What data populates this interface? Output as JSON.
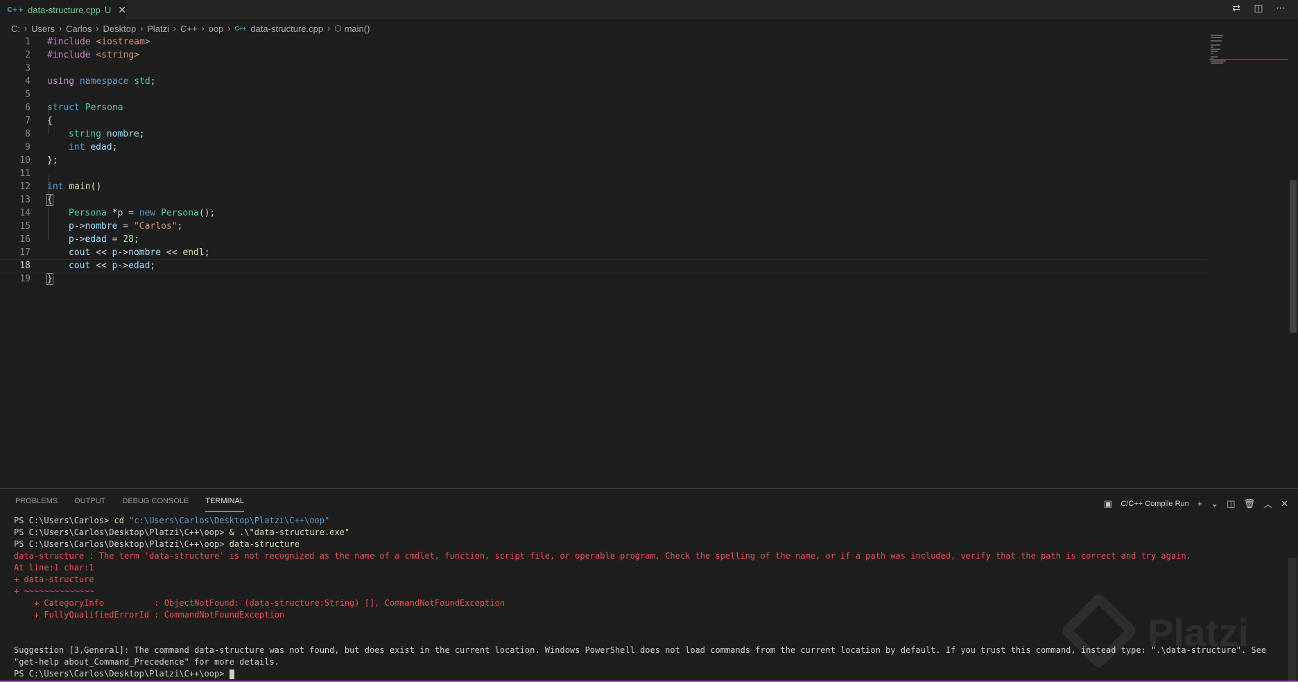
{
  "tab": {
    "icon": "C++",
    "label": "data-structure.cpp",
    "status": "U",
    "close": "✕"
  },
  "tab_actions": [
    "compare-icon",
    "split-editor-icon",
    "more-actions-icon"
  ],
  "breadcrumb": {
    "parts": [
      "C:",
      "Users",
      "Carlos",
      "Desktop",
      "Platzi",
      "C++",
      "oop"
    ],
    "file": "data-structure.cpp",
    "file_icon": "C++",
    "symbol": "main()"
  },
  "editor": {
    "current_line": 18,
    "lines": [
      {
        "n": "1"
      },
      {
        "n": "2"
      },
      {
        "n": "3"
      },
      {
        "n": "4"
      },
      {
        "n": "5"
      },
      {
        "n": "6"
      },
      {
        "n": "7"
      },
      {
        "n": "8"
      },
      {
        "n": "9"
      },
      {
        "n": "10"
      },
      {
        "n": "11"
      },
      {
        "n": "12"
      },
      {
        "n": "13"
      },
      {
        "n": "14"
      },
      {
        "n": "15"
      },
      {
        "n": "16"
      },
      {
        "n": "17"
      },
      {
        "n": "18"
      },
      {
        "n": "19"
      }
    ],
    "tokens": {
      "l1": [
        "#include",
        " ",
        "<iostream>"
      ],
      "l2": [
        "#include",
        " ",
        "<string>"
      ],
      "l4": [
        "using",
        " ",
        "namespace",
        " ",
        "std",
        ";"
      ],
      "l6": [
        "struct",
        " ",
        "Persona"
      ],
      "l7": [
        "{"
      ],
      "l8": [
        "string",
        " ",
        "nombre",
        ";"
      ],
      "l9": [
        "int",
        " ",
        "edad",
        ";"
      ],
      "l10": [
        "};"
      ],
      "l12": [
        "int",
        " ",
        "main",
        "()"
      ],
      "l13": [
        "{"
      ],
      "l14": [
        "Persona",
        " *",
        "p",
        " = ",
        "new",
        " ",
        "Persona",
        "();"
      ],
      "l15": [
        "p",
        "->",
        "nombre",
        " = ",
        "\"Carlos\"",
        ";"
      ],
      "l16": [
        "p",
        "->",
        "edad",
        " = ",
        "28",
        ";"
      ],
      "l17": [
        "cout",
        " << ",
        "p",
        "->",
        "nombre",
        " << ",
        "endl",
        ";"
      ],
      "l18": [
        "cout",
        " << ",
        "p",
        "->",
        "edad",
        ";"
      ],
      "l19": [
        "}"
      ]
    }
  },
  "panel": {
    "tabs": [
      "PROBLEMS",
      "OUTPUT",
      "DEBUG CONSOLE",
      "TERMINAL"
    ],
    "active_tab": "TERMINAL",
    "terminal_name": "C/C++ Compile Run",
    "actions": [
      "terminal-icon",
      "new-terminal-icon",
      "dropdown-icon",
      "split-terminal-icon",
      "trash-icon",
      "maximize-icon",
      "close-icon"
    ]
  },
  "terminal": {
    "l1_prompt": "PS C:\\Users\\Carlos> ",
    "l1_cmd": "cd",
    "l1_arg": " \"c:\\Users\\Carlos\\Desktop\\Platzi\\C++\\oop\"",
    "l2_prompt": "PS C:\\Users\\Carlos\\Desktop\\Platzi\\C++\\oop> ",
    "l2_cmd": "& .\\\"data-structure.exe\"",
    "l3_prompt": "PS C:\\Users\\Carlos\\Desktop\\Platzi\\C++\\oop> ",
    "l3_cmd": "data-structure",
    "err1": "data-structure : The term 'data-structure' is not recognized as the name of a cmdlet, function, script file, or operable program. Check the spelling of the name, or if a path was included, verify that the path is correct and try again.",
    "err2": "At line:1 char:1",
    "err3": "+ data-structure",
    "err4": "+ ~~~~~~~~~~~~~~",
    "err5": "    + CategoryInfo          : ObjectNotFound: (data-structure:String) [], CommandNotFoundException",
    "err6": "    + FullyQualifiedErrorId : CommandNotFoundException",
    "suggestion": "Suggestion [3,General]: The command data-structure was not found, but does exist in the current location. Windows PowerShell does not load commands from the current location by default. If you trust this command, instead type: \".\\data-structure\". See \"get-help about_Command_Precedence\" for more details.",
    "last_prompt": "PS C:\\Users\\Carlos\\Desktop\\Platzi\\C++\\oop> "
  },
  "watermark": {
    "text": "Platzi"
  }
}
